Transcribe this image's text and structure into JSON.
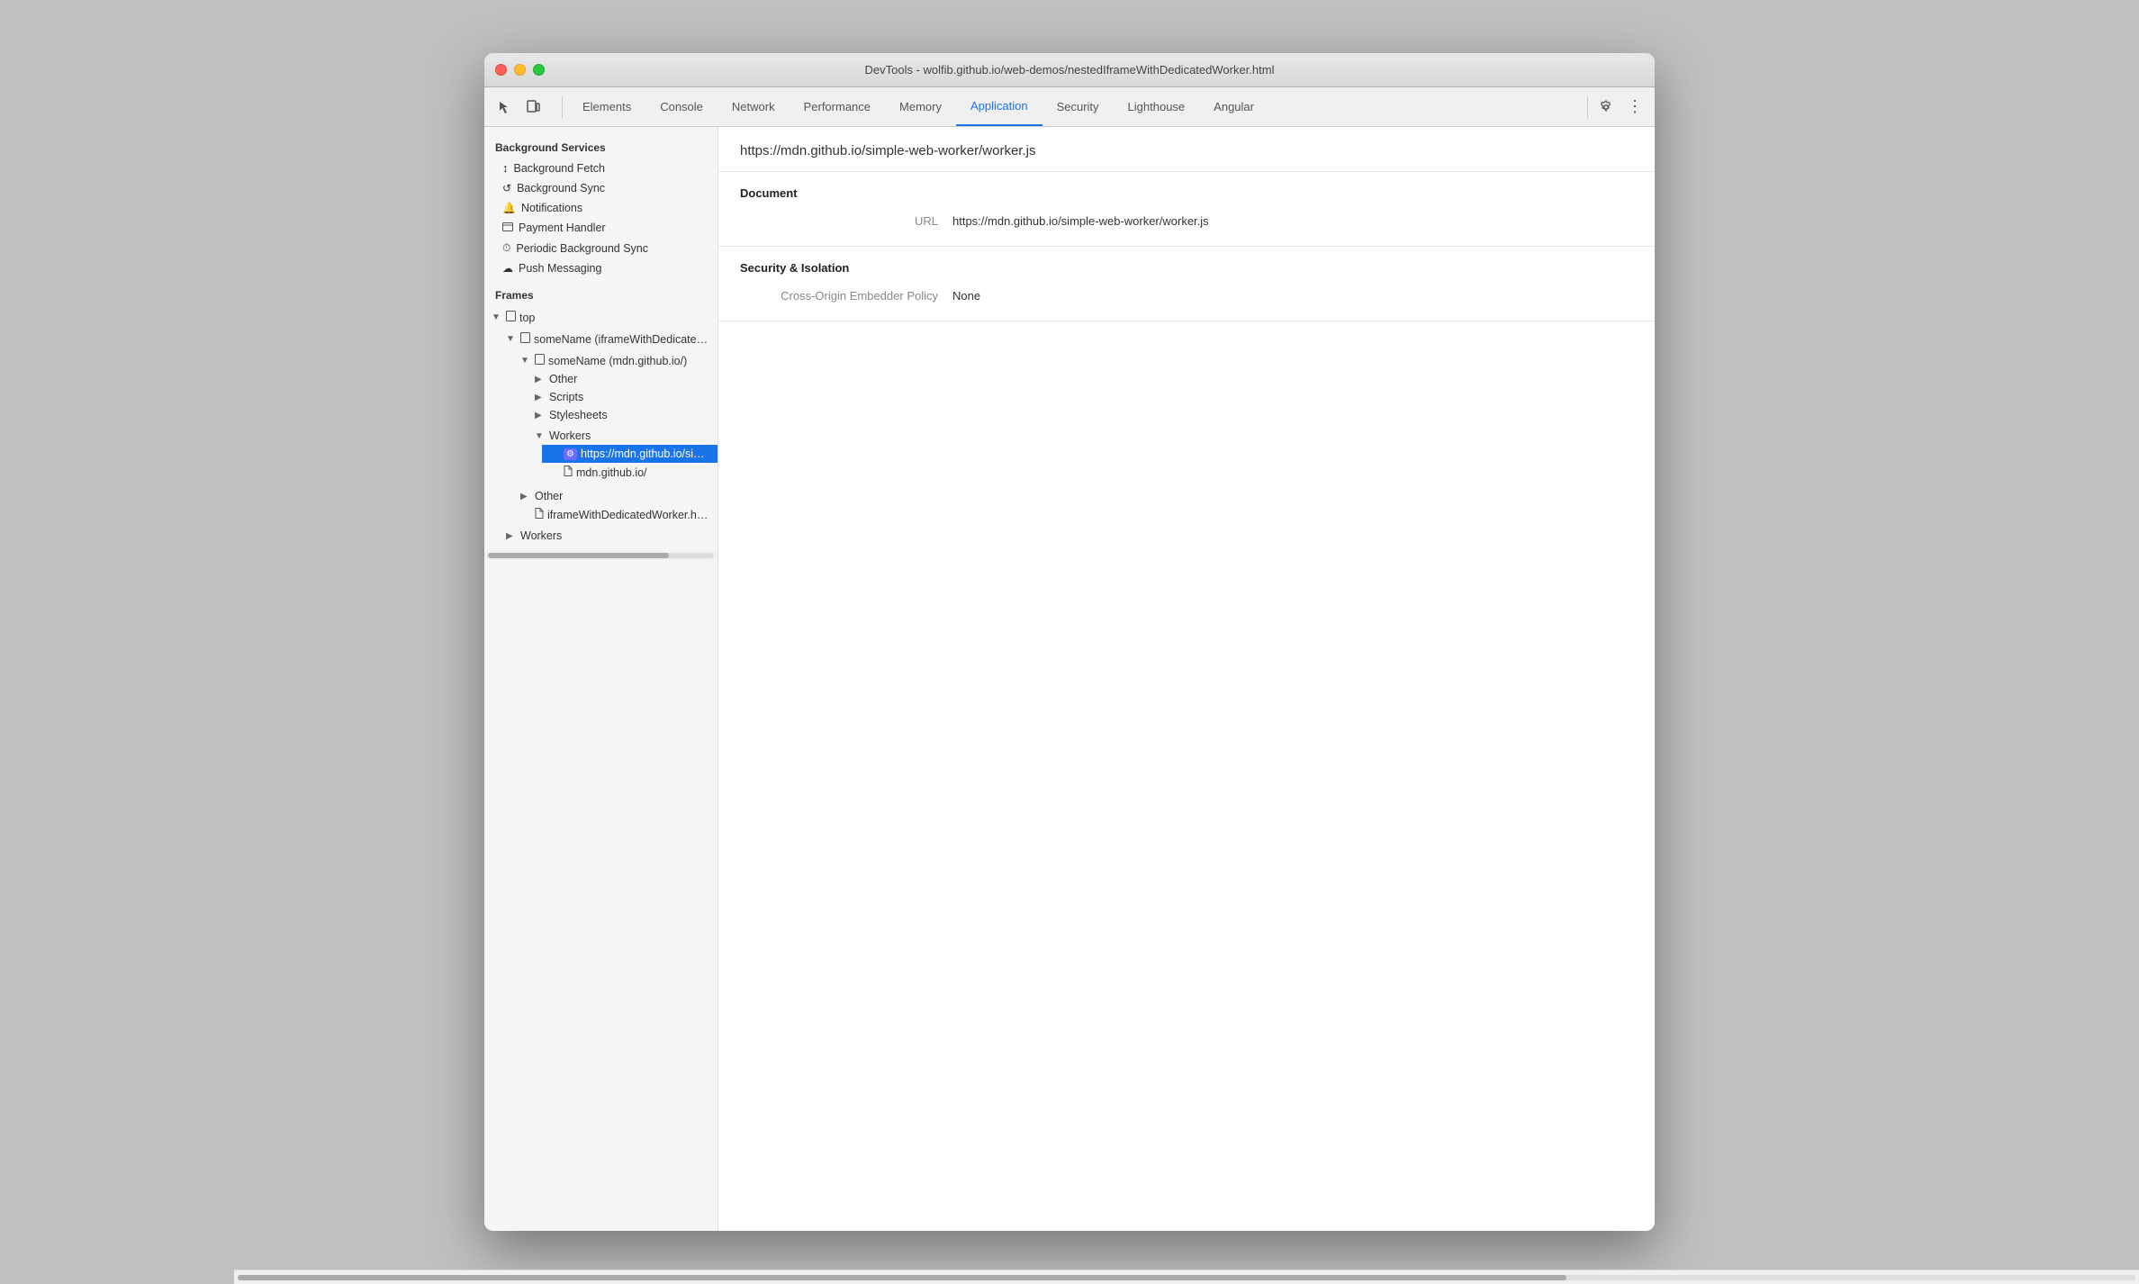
{
  "window": {
    "title": "DevTools - wolfib.github.io/web-demos/nestedIframeWithDedicatedWorker.html",
    "traffic_lights": [
      "red",
      "yellow",
      "green"
    ]
  },
  "toolbar": {
    "icons": [
      {
        "name": "cursor-icon",
        "symbol": "⬡",
        "label": "Inspect element"
      },
      {
        "name": "device-icon",
        "symbol": "⬜",
        "label": "Toggle device"
      }
    ],
    "tabs": [
      {
        "id": "elements",
        "label": "Elements",
        "active": false
      },
      {
        "id": "console",
        "label": "Console",
        "active": false
      },
      {
        "id": "network",
        "label": "Network",
        "active": false
      },
      {
        "id": "performance",
        "label": "Performance",
        "active": false
      },
      {
        "id": "memory",
        "label": "Memory",
        "active": false
      },
      {
        "id": "application",
        "label": "Application",
        "active": true
      },
      {
        "id": "security",
        "label": "Security",
        "active": false
      },
      {
        "id": "lighthouse",
        "label": "Lighthouse",
        "active": false
      },
      {
        "id": "angular",
        "label": "Angular",
        "active": false
      }
    ],
    "actions": [
      {
        "name": "settings-icon",
        "symbol": "⚙"
      },
      {
        "name": "more-icon",
        "symbol": "⋮"
      }
    ]
  },
  "sidebar": {
    "background_services_label": "Background Services",
    "items": [
      {
        "id": "background-fetch",
        "label": "Background Fetch",
        "icon": "↕"
      },
      {
        "id": "background-sync",
        "label": "Background Sync",
        "icon": "↺"
      },
      {
        "id": "notifications",
        "label": "Notifications",
        "icon": "🔔"
      },
      {
        "id": "payment-handler",
        "label": "Payment Handler",
        "icon": "⬜"
      },
      {
        "id": "periodic-background-sync",
        "label": "Periodic Background Sync",
        "icon": "⏱"
      },
      {
        "id": "push-messaging",
        "label": "Push Messaging",
        "icon": "☁"
      }
    ],
    "frames_label": "Frames",
    "frames_tree": {
      "top": {
        "label": "top",
        "icon": "page",
        "children": [
          {
            "label": "someName (iframeWithDedicatedWorker.html)",
            "icon": "page",
            "expanded": true,
            "children": [
              {
                "label": "someName (mdn.github.io/)",
                "icon": "page",
                "expanded": true,
                "children": [
                  {
                    "label": "Other",
                    "icon": "folder",
                    "expanded": false,
                    "children": []
                  },
                  {
                    "label": "Scripts",
                    "icon": "folder",
                    "expanded": false,
                    "children": []
                  },
                  {
                    "label": "Stylesheets",
                    "icon": "folder",
                    "expanded": false,
                    "children": []
                  },
                  {
                    "label": "Workers",
                    "icon": "folder",
                    "expanded": true,
                    "children": [
                      {
                        "label": "https://mdn.github.io/simple-web-worker",
                        "icon": "gear",
                        "selected": true
                      },
                      {
                        "label": "mdn.github.io/",
                        "icon": "page"
                      }
                    ]
                  }
                ]
              },
              {
                "label": "Other",
                "icon": "folder",
                "expanded": false,
                "children": []
              },
              {
                "label": "iframeWithDedicatedWorker.html",
                "icon": "page"
              }
            ]
          }
        ]
      }
    }
  },
  "detail": {
    "url": "https://mdn.github.io/simple-web-worker/worker.js",
    "document_section": {
      "title": "Document",
      "rows": [
        {
          "key": "URL",
          "value": "https://mdn.github.io/simple-web-worker/worker.js"
        }
      ]
    },
    "security_section": {
      "title": "Security & Isolation",
      "rows": [
        {
          "key": "Cross-Origin Embedder Policy",
          "value": "None"
        }
      ]
    }
  }
}
